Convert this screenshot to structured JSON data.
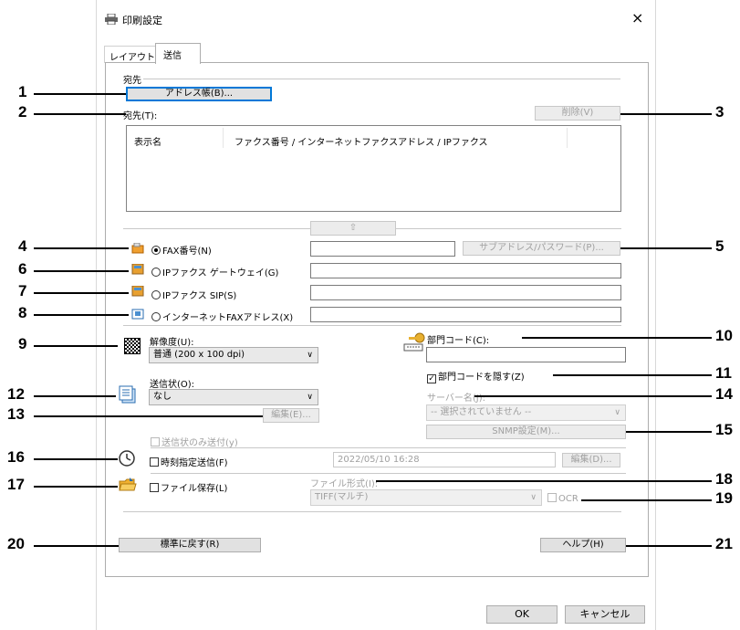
{
  "window": {
    "title": "印刷設定",
    "close_glyph": "×"
  },
  "tabs": [
    {
      "label": "レイアウト"
    },
    {
      "label": "送信"
    }
  ],
  "destination": {
    "group_label": "宛先",
    "address_book_button": "アドレス帳(B)...",
    "destination_label": "宛先(T):",
    "delete_button": "削除(V)",
    "columns": [
      "表示名",
      "ファクス番号 / インターネットファクスアドレス / IPファクス"
    ],
    "up_arrow": "⇧",
    "options": [
      {
        "label": "FAX番号(N)",
        "selected": true
      },
      {
        "label": "IPファクス ゲートウェイ(G)",
        "selected": false
      },
      {
        "label": "IPファクス SIP(S)",
        "selected": false
      },
      {
        "label": "インターネットFAXアドレス(X)",
        "selected": false
      }
    ],
    "subaddress_button": "サブアドレス/パスワード(P)..."
  },
  "resolution": {
    "label": "解像度(U):",
    "value": "普通 (200 x 100 dpi)"
  },
  "cover_sheet": {
    "label": "送信状(O):",
    "value": "なし",
    "edit_button": "編集(E)...",
    "cover_only": "送信状のみ送付(y)"
  },
  "department": {
    "label": "部門コード(C):",
    "value": "",
    "hide_label": "部門コードを隠す(Z)",
    "hide_checked": true
  },
  "server": {
    "label": "サーバー名(J):",
    "value": "-- 選択されていません --",
    "snmp_button": "SNMP設定(M)..."
  },
  "scheduled": {
    "label": "時刻指定送信(F)",
    "checked": false,
    "datetime": "2022/05/10 16:28",
    "edit_button": "編集(D)..."
  },
  "file_save": {
    "label": "ファイル保存(L)",
    "checked": false,
    "format_label": "ファイル形式(I):",
    "format_value": "TIFF(マルチ)",
    "ocr_label": "OCR"
  },
  "footer": {
    "restore_button": "標準に戻す(R)",
    "help_button": "ヘルプ(H)",
    "ok_button": "OK",
    "cancel_button": "キャンセル"
  },
  "callouts": [
    "1",
    "2",
    "3",
    "4",
    "5",
    "6",
    "7",
    "8",
    "9",
    "10",
    "11",
    "12",
    "13",
    "14",
    "15",
    "16",
    "17",
    "18",
    "19",
    "20",
    "21"
  ]
}
